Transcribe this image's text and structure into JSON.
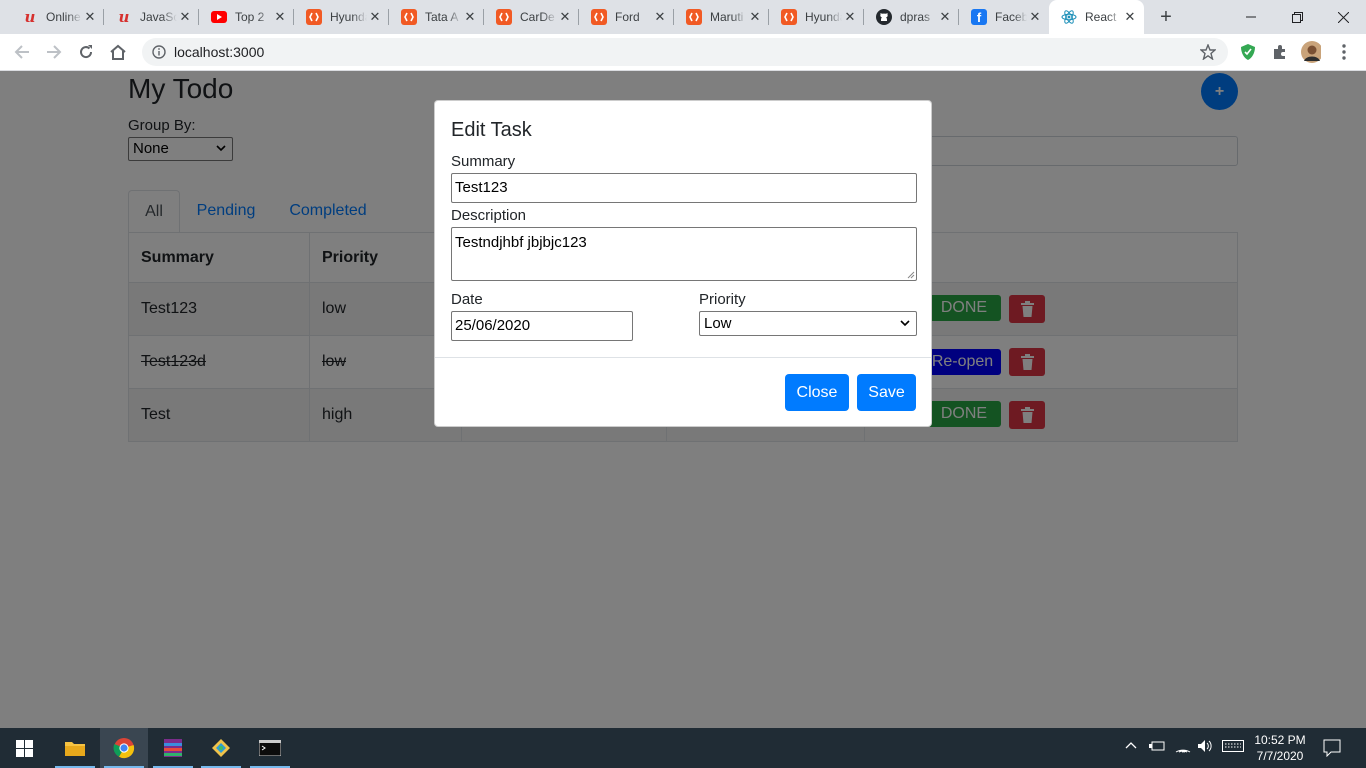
{
  "browser": {
    "tabs": [
      {
        "title": "Online",
        "icon": "udemy-icon"
      },
      {
        "title": "JavaScript",
        "icon": "udemy-icon"
      },
      {
        "title": "Top 2",
        "icon": "youtube-icon"
      },
      {
        "title": "Hyundai",
        "icon": "orange-site-icon"
      },
      {
        "title": "Tata A",
        "icon": "orange-site-icon"
      },
      {
        "title": "CarDe",
        "icon": "orange-site-icon"
      },
      {
        "title": "Ford",
        "icon": "orange-site-icon"
      },
      {
        "title": "Maruti",
        "icon": "orange-site-icon"
      },
      {
        "title": "Hyundai",
        "icon": "orange-site-icon"
      },
      {
        "title": "dpras",
        "icon": "github-icon"
      },
      {
        "title": "Faceb",
        "icon": "facebook-icon"
      },
      {
        "title": "React",
        "icon": "react-icon",
        "active": true
      }
    ],
    "url": "localhost:3000"
  },
  "app": {
    "title": "My Todo",
    "group_by_label": "Group By:",
    "group_by_value": "None",
    "add_button": "+",
    "tabs": [
      "All",
      "Pending",
      "Completed"
    ],
    "active_tab": "All",
    "columns": [
      "Summary",
      "Priority"
    ],
    "rows": [
      {
        "summary": "Test123",
        "priority": "low",
        "action": "DONE",
        "completed": false
      },
      {
        "summary": "Test123d",
        "priority": "low",
        "action": "Re-open",
        "completed": true
      },
      {
        "summary": "Test",
        "priority": "high",
        "action": "DONE",
        "completed": false
      }
    ]
  },
  "modal": {
    "title": "Edit Task",
    "summary_label": "Summary",
    "summary_value": "Test123",
    "description_label": "Description",
    "description_value": "Testndjhbf jbjbjc123",
    "date_label": "Date",
    "date_value": "25/06/2020",
    "priority_label": "Priority",
    "priority_value": "Low",
    "close_button": "Close",
    "save_button": "Save"
  },
  "taskbar": {
    "time": "10:52 PM",
    "date": "7/7/2020"
  },
  "colors": {
    "primary": "#007bff",
    "success": "#28a745",
    "danger": "#dc3545",
    "reopen": "#0000ff"
  }
}
